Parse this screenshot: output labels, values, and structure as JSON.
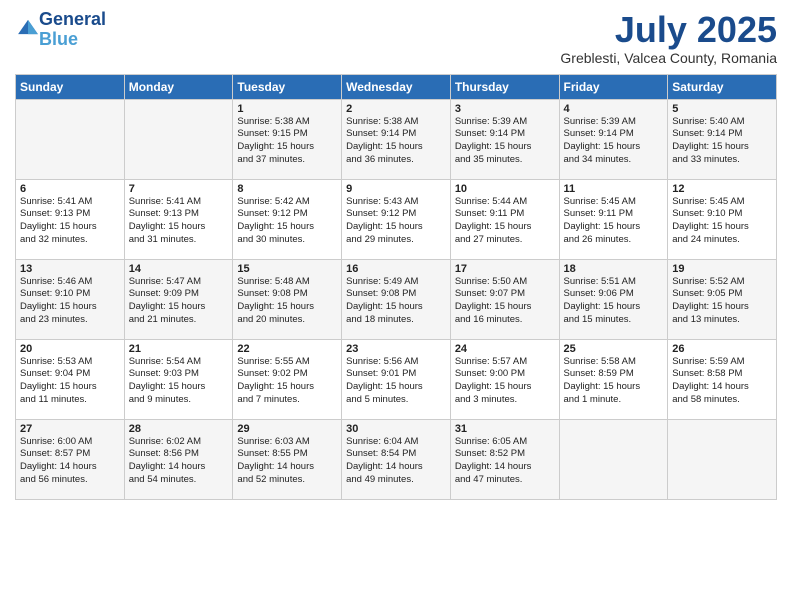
{
  "header": {
    "logo_line1": "General",
    "logo_line2": "Blue",
    "month": "July 2025",
    "location": "Greblesti, Valcea County, Romania"
  },
  "days_of_week": [
    "Sunday",
    "Monday",
    "Tuesday",
    "Wednesday",
    "Thursday",
    "Friday",
    "Saturday"
  ],
  "weeks": [
    [
      {
        "day": "",
        "content": ""
      },
      {
        "day": "",
        "content": ""
      },
      {
        "day": "1",
        "content": "Sunrise: 5:38 AM\nSunset: 9:15 PM\nDaylight: 15 hours\nand 37 minutes."
      },
      {
        "day": "2",
        "content": "Sunrise: 5:38 AM\nSunset: 9:14 PM\nDaylight: 15 hours\nand 36 minutes."
      },
      {
        "day": "3",
        "content": "Sunrise: 5:39 AM\nSunset: 9:14 PM\nDaylight: 15 hours\nand 35 minutes."
      },
      {
        "day": "4",
        "content": "Sunrise: 5:39 AM\nSunset: 9:14 PM\nDaylight: 15 hours\nand 34 minutes."
      },
      {
        "day": "5",
        "content": "Sunrise: 5:40 AM\nSunset: 9:14 PM\nDaylight: 15 hours\nand 33 minutes."
      }
    ],
    [
      {
        "day": "6",
        "content": "Sunrise: 5:41 AM\nSunset: 9:13 PM\nDaylight: 15 hours\nand 32 minutes."
      },
      {
        "day": "7",
        "content": "Sunrise: 5:41 AM\nSunset: 9:13 PM\nDaylight: 15 hours\nand 31 minutes."
      },
      {
        "day": "8",
        "content": "Sunrise: 5:42 AM\nSunset: 9:12 PM\nDaylight: 15 hours\nand 30 minutes."
      },
      {
        "day": "9",
        "content": "Sunrise: 5:43 AM\nSunset: 9:12 PM\nDaylight: 15 hours\nand 29 minutes."
      },
      {
        "day": "10",
        "content": "Sunrise: 5:44 AM\nSunset: 9:11 PM\nDaylight: 15 hours\nand 27 minutes."
      },
      {
        "day": "11",
        "content": "Sunrise: 5:45 AM\nSunset: 9:11 PM\nDaylight: 15 hours\nand 26 minutes."
      },
      {
        "day": "12",
        "content": "Sunrise: 5:45 AM\nSunset: 9:10 PM\nDaylight: 15 hours\nand 24 minutes."
      }
    ],
    [
      {
        "day": "13",
        "content": "Sunrise: 5:46 AM\nSunset: 9:10 PM\nDaylight: 15 hours\nand 23 minutes."
      },
      {
        "day": "14",
        "content": "Sunrise: 5:47 AM\nSunset: 9:09 PM\nDaylight: 15 hours\nand 21 minutes."
      },
      {
        "day": "15",
        "content": "Sunrise: 5:48 AM\nSunset: 9:08 PM\nDaylight: 15 hours\nand 20 minutes."
      },
      {
        "day": "16",
        "content": "Sunrise: 5:49 AM\nSunset: 9:08 PM\nDaylight: 15 hours\nand 18 minutes."
      },
      {
        "day": "17",
        "content": "Sunrise: 5:50 AM\nSunset: 9:07 PM\nDaylight: 15 hours\nand 16 minutes."
      },
      {
        "day": "18",
        "content": "Sunrise: 5:51 AM\nSunset: 9:06 PM\nDaylight: 15 hours\nand 15 minutes."
      },
      {
        "day": "19",
        "content": "Sunrise: 5:52 AM\nSunset: 9:05 PM\nDaylight: 15 hours\nand 13 minutes."
      }
    ],
    [
      {
        "day": "20",
        "content": "Sunrise: 5:53 AM\nSunset: 9:04 PM\nDaylight: 15 hours\nand 11 minutes."
      },
      {
        "day": "21",
        "content": "Sunrise: 5:54 AM\nSunset: 9:03 PM\nDaylight: 15 hours\nand 9 minutes."
      },
      {
        "day": "22",
        "content": "Sunrise: 5:55 AM\nSunset: 9:02 PM\nDaylight: 15 hours\nand 7 minutes."
      },
      {
        "day": "23",
        "content": "Sunrise: 5:56 AM\nSunset: 9:01 PM\nDaylight: 15 hours\nand 5 minutes."
      },
      {
        "day": "24",
        "content": "Sunrise: 5:57 AM\nSunset: 9:00 PM\nDaylight: 15 hours\nand 3 minutes."
      },
      {
        "day": "25",
        "content": "Sunrise: 5:58 AM\nSunset: 8:59 PM\nDaylight: 15 hours\nand 1 minute."
      },
      {
        "day": "26",
        "content": "Sunrise: 5:59 AM\nSunset: 8:58 PM\nDaylight: 14 hours\nand 58 minutes."
      }
    ],
    [
      {
        "day": "27",
        "content": "Sunrise: 6:00 AM\nSunset: 8:57 PM\nDaylight: 14 hours\nand 56 minutes."
      },
      {
        "day": "28",
        "content": "Sunrise: 6:02 AM\nSunset: 8:56 PM\nDaylight: 14 hours\nand 54 minutes."
      },
      {
        "day": "29",
        "content": "Sunrise: 6:03 AM\nSunset: 8:55 PM\nDaylight: 14 hours\nand 52 minutes."
      },
      {
        "day": "30",
        "content": "Sunrise: 6:04 AM\nSunset: 8:54 PM\nDaylight: 14 hours\nand 49 minutes."
      },
      {
        "day": "31",
        "content": "Sunrise: 6:05 AM\nSunset: 8:52 PM\nDaylight: 14 hours\nand 47 minutes."
      },
      {
        "day": "",
        "content": ""
      },
      {
        "day": "",
        "content": ""
      }
    ]
  ]
}
